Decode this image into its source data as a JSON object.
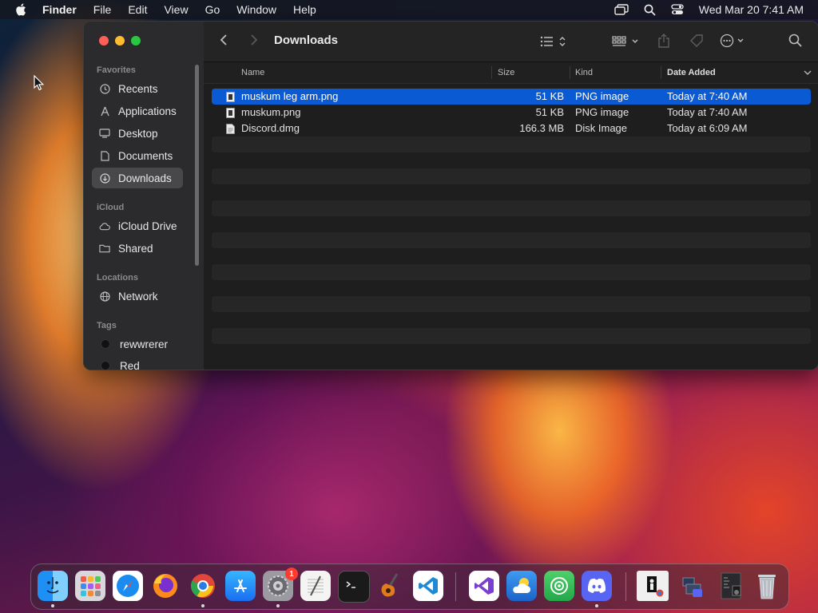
{
  "menubar": {
    "app_name": "Finder",
    "menus": [
      "File",
      "Edit",
      "View",
      "Go",
      "Window",
      "Help"
    ],
    "clock": "Wed Mar 20  7:41 AM"
  },
  "window": {
    "title": "Downloads",
    "sidebar": {
      "favorites_label": "Favorites",
      "favorites": [
        {
          "label": "Recents",
          "icon": "clock-icon"
        },
        {
          "label": "Applications",
          "icon": "applications-icon"
        },
        {
          "label": "Desktop",
          "icon": "desktop-icon"
        },
        {
          "label": "Documents",
          "icon": "document-icon"
        },
        {
          "label": "Downloads",
          "icon": "download-icon",
          "active": true
        }
      ],
      "icloud_label": "iCloud",
      "icloud": [
        {
          "label": "iCloud Drive",
          "icon": "cloud-icon"
        },
        {
          "label": "Shared",
          "icon": "shared-folder-icon"
        }
      ],
      "locations_label": "Locations",
      "locations": [
        {
          "label": "Network",
          "icon": "network-icon"
        }
      ],
      "tags_label": "Tags",
      "tags": [
        {
          "label": "rewwrerer",
          "color": "#111111"
        },
        {
          "label": "Red",
          "color": "#111111"
        }
      ]
    },
    "columns": {
      "name": "Name",
      "size": "Size",
      "kind": "Kind",
      "date_added": "Date Added"
    },
    "files": [
      {
        "name": "muskum leg arm.png",
        "size": "51 KB",
        "kind": "PNG image",
        "date": "Today at 7:40 AM",
        "selected": true
      },
      {
        "name": "muskum.png",
        "size": "51 KB",
        "kind": "PNG image",
        "date": "Today at 7:40 AM",
        "selected": false
      },
      {
        "name": "Discord.dmg",
        "size": "166.3 MB",
        "kind": "Disk Image",
        "date": "Today at 6:09 AM",
        "selected": false
      }
    ]
  },
  "dock": {
    "apps": [
      "finder-icon",
      "launchpad-icon",
      "safari-icon",
      "firefox-icon",
      "chrome-icon",
      "app-store-icon",
      "system-settings-icon",
      "textedit-icon",
      "terminal-icon",
      "garageband-icon",
      "vscode-icon",
      "visual-studio-icon",
      "weather-icon",
      "find-my-icon",
      "discord-icon",
      "preview-window-icon",
      "stack-icon",
      "downloads-stack-icon",
      "trash-icon"
    ],
    "settings_badge": "1"
  },
  "colors": {
    "selection": "#0a5ad4",
    "window_bg": "#1e1e1e",
    "sidebar_bg": "#2b2b2d"
  }
}
